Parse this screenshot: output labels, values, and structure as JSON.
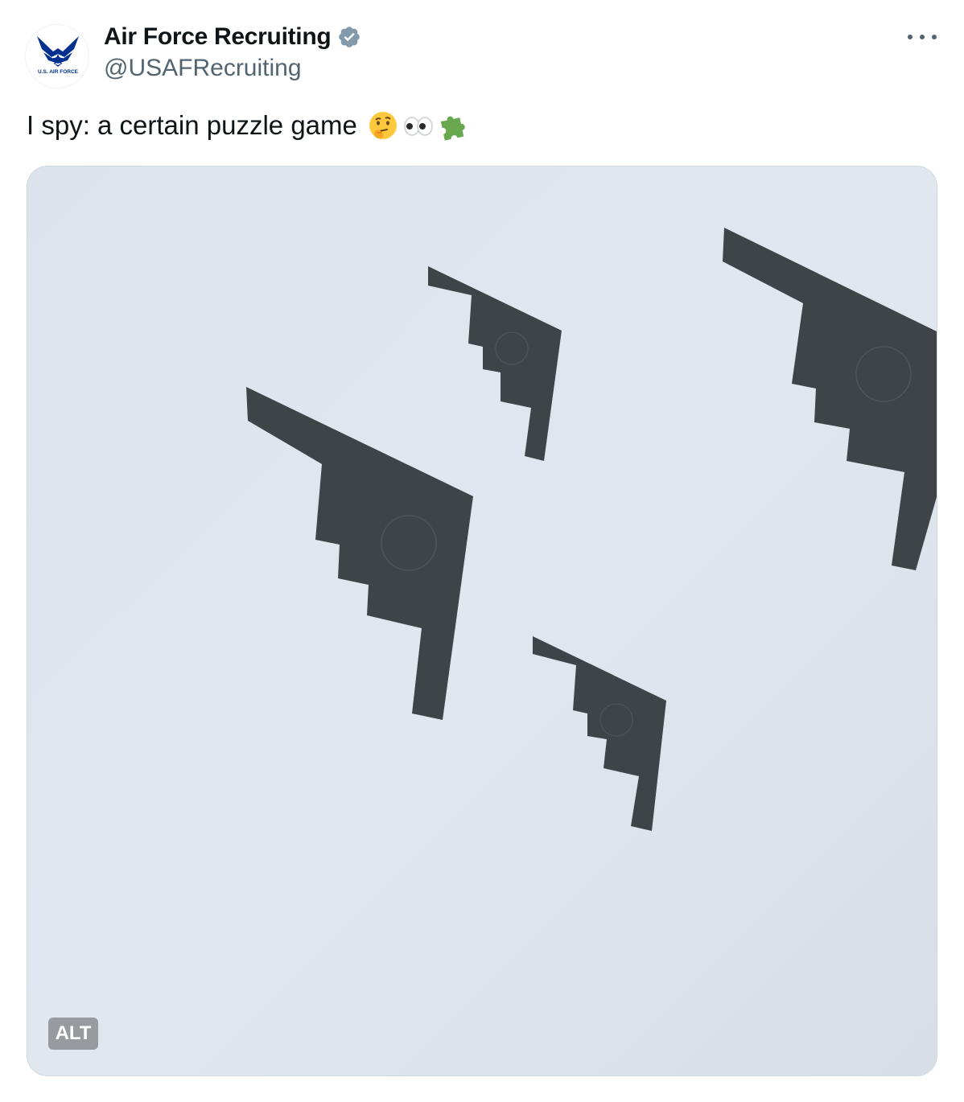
{
  "author": {
    "name": "Air Force Recruiting",
    "handle": "@USAFRecruiting",
    "verified": true,
    "avatar_icon": "us-air-force-logo-icon",
    "avatar_caption": "U.S. AIR FORCE"
  },
  "tweet": {
    "text": "I spy: a certain puzzle game",
    "emojis": [
      "thinking-face-emoji",
      "eyes-emoji",
      "puzzle-piece-emoji"
    ]
  },
  "media": {
    "type": "photo",
    "alt_badge": "ALT"
  },
  "more_icon": "more-horizontal-icon",
  "colors": {
    "text_primary": "#0f1419",
    "text_secondary": "#536471",
    "verified": "#829aab",
    "sky": "#dfe5ee",
    "aircraft": "#3f4448",
    "af_blue": "#00308f"
  }
}
